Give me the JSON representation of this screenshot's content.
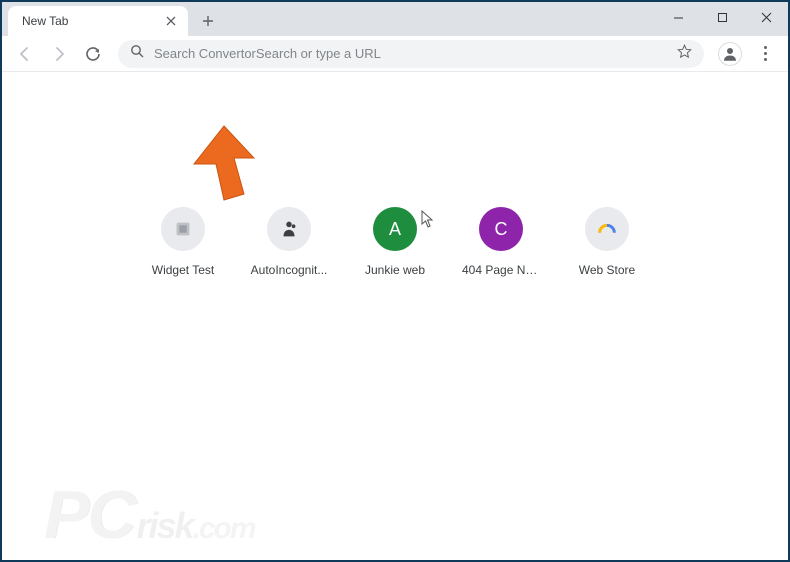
{
  "tab": {
    "title": "New Tab"
  },
  "omnibox": {
    "placeholder": "Search ConvertorSearch or type a URL"
  },
  "shortcuts": [
    {
      "label": "Widget Test",
      "bg": "#e8eaed",
      "fg": "#9aa0a6",
      "letter": ""
    },
    {
      "label": "AutoIncognit...",
      "bg": "#e8eaed",
      "fg": "#3c4043",
      "letter": ""
    },
    {
      "label": "Junkie web",
      "bg": "#1e8e3e",
      "fg": "#ffffff",
      "letter": "A"
    },
    {
      "label": "404 Page Not ...",
      "bg": "#8e24aa",
      "fg": "#ffffff",
      "letter": "C"
    },
    {
      "label": "Web Store",
      "bg": "#e8eaed",
      "fg": "#5f6368",
      "letter": ""
    }
  ],
  "watermark": {
    "pc": "PC",
    "risk": "risk",
    "com": ".com"
  },
  "colors": {
    "arrow": "#ec6a1f"
  }
}
